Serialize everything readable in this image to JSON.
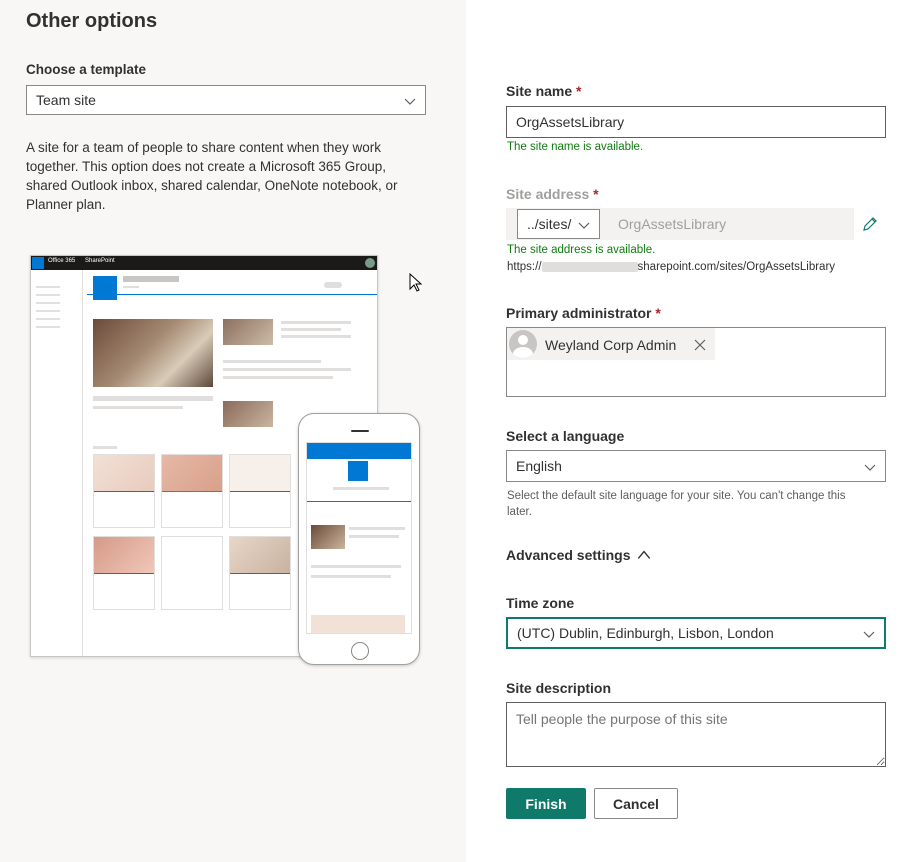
{
  "left": {
    "heading": "Other options",
    "template_label": "Choose a template",
    "template_value": "Team site",
    "template_description": "A site for a team of people to share content when they work together. This option does not create a Microsoft 365 Group, shared Outlook inbox, shared calendar, OneNote notebook, or Planner plan.",
    "illustration": {
      "suite_name": "Office 365",
      "app_name": "SharePoint"
    }
  },
  "form": {
    "site_name": {
      "label": "Site name",
      "required_mark": "*",
      "value": "OrgAssetsLibrary",
      "status": "The site name is available."
    },
    "site_address": {
      "label": "Site address",
      "required_mark": "*",
      "prefix_value": "../sites/",
      "value": "OrgAssetsLibrary",
      "status": "The site address is available.",
      "url_prefix": "https://",
      "url_suffix": "sharepoint.com/sites/OrgAssetsLibrary"
    },
    "primary_admin": {
      "label": "Primary administrator",
      "required_mark": "*",
      "persona_name": "Weyland Corp Admin"
    },
    "language": {
      "label": "Select a language",
      "value": "English",
      "help": "Select the default site language for your site. You can't change this later."
    },
    "advanced_settings_label": "Advanced settings",
    "time_zone": {
      "label": "Time zone",
      "value": "(UTC) Dublin, Edinburgh, Lisbon, London"
    },
    "site_description": {
      "label": "Site description",
      "placeholder": "Tell people the purpose of this site"
    },
    "finish_label": "Finish",
    "cancel_label": "Cancel"
  },
  "colors": {
    "accent": "#0f7a6a",
    "available": "#107c10",
    "required": "#a4262c",
    "sharepoint_blue": "#0078d4"
  },
  "icons": {
    "dropdown": "chevron-down-icon",
    "edit": "pencil-icon",
    "remove": "close-icon",
    "advanced": "chevron-up-icon",
    "persona": "avatar-icon"
  }
}
